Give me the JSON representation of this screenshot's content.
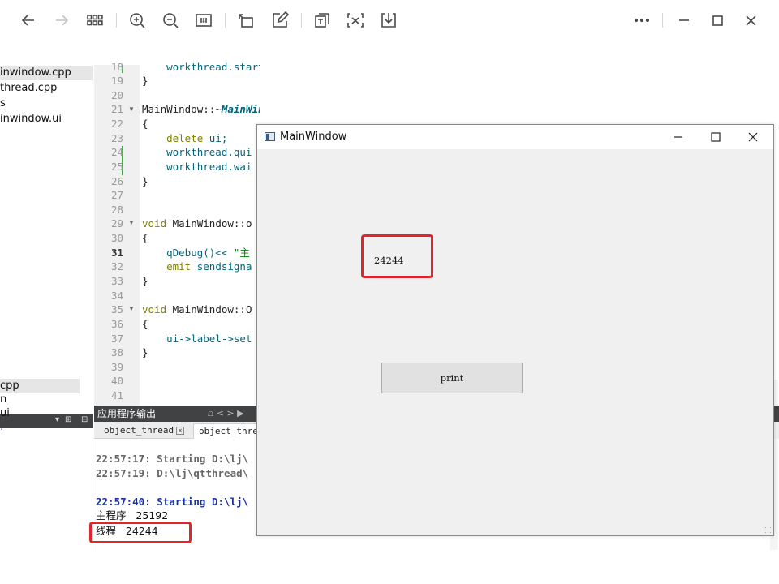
{
  "toolbar": {
    "icons": [
      "back-arrow-icon",
      "forward-arrow-icon",
      "grid-view-icon",
      "zoom-in-icon",
      "zoom-out-icon",
      "actual-size-icon",
      "rotate-icon",
      "edit-icon",
      "extract-text-icon",
      "formula-icon",
      "download-icon",
      "more-icon",
      "minimize-icon",
      "maximize-icon",
      "close-icon"
    ]
  },
  "project_tree": {
    "files": [
      "inwindow.cpp",
      "thread.cpp",
      "s",
      "inwindow.ui"
    ],
    "open_files": [
      "cpp",
      "n",
      "ui",
      "."
    ],
    "header_controls": [
      "▾",
      "⊞",
      "⊟"
    ]
  },
  "editor": {
    "line_numbers": [
      "18",
      "19",
      "20",
      "21",
      "22",
      "23",
      "24",
      "25",
      "26",
      "27",
      "28",
      "29",
      "30",
      "31",
      "32",
      "33",
      "34",
      "35",
      "36",
      "37",
      "38",
      "39",
      "40",
      "41"
    ],
    "line_partial": "18",
    "lines": {
      "l18": "    workthread.start();",
      "l19": "}",
      "l21a": "MainWindow::~",
      "l21b": "MainWindow",
      "l21c": "()",
      "l22": "{",
      "l23a": "    delete",
      "l23b": " ui;",
      "l24": "    workthread.qui",
      "l25": "    workthread.wai",
      "l26": "}",
      "l29a": "void",
      "l29b": " MainWindow::o",
      "l30": "{",
      "l31a": "    qDebug()<< ",
      "l31b": "\"主",
      "l32a": "    emit",
      "l32b": " sendsigna",
      "l33": "}",
      "l35a": "void",
      "l35b": " MainWindow::O",
      "l36": "{",
      "l37": "    ui->label->set",
      "l38": "}"
    }
  },
  "output_pane": {
    "title": "应用程序输出",
    "tabs": [
      "object_thread",
      "object_threa"
    ],
    "lines": [
      "22:57:17: Starting D:\\lj\\",
      "22:57:19: D:\\lj\\qtthread\\",
      "22:57:40: Starting D:\\lj\\",
      "主程序   25192",
      "线程   24244"
    ]
  },
  "dialog": {
    "title": "MainWindow",
    "label_text": "24244",
    "button_label": "print"
  }
}
